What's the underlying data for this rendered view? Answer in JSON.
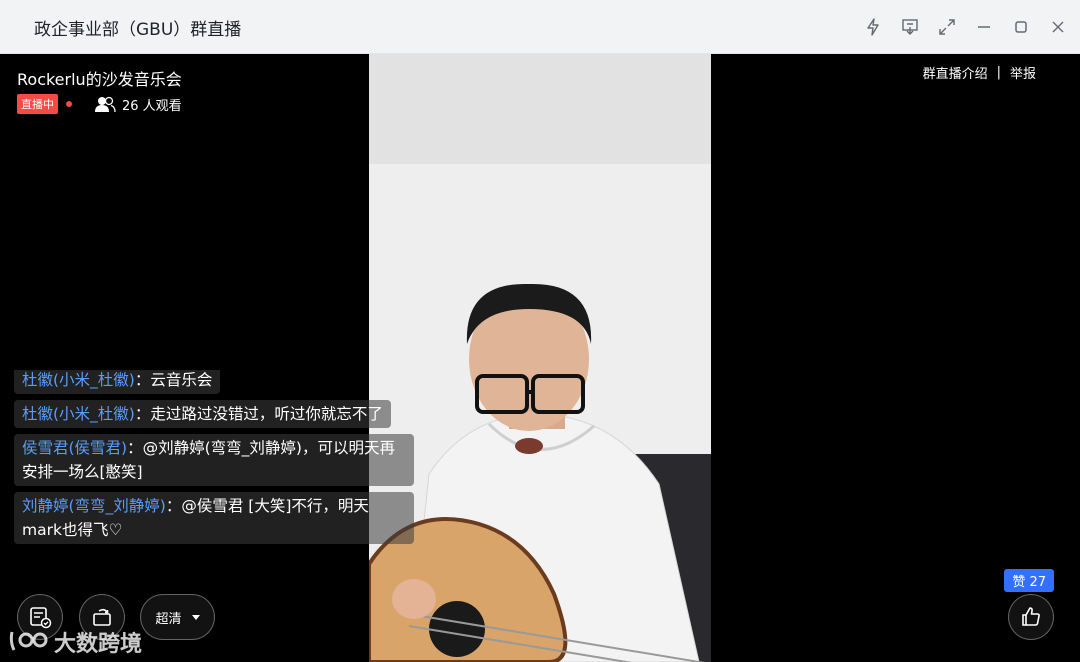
{
  "window": {
    "title": "政企事业部（GBU）群直播"
  },
  "stream": {
    "title": "Rockerlu的沙发音乐会",
    "live_badge": "直播中",
    "viewers": "26 人观看",
    "intro_link": "群直播介绍",
    "separator": "|",
    "report_link": "举报"
  },
  "chat": {
    "messages": [
      {
        "name": "杜徽(小米_杜徽)",
        "text": "：云音乐会"
      },
      {
        "name": "杜徽(小米_杜徽)",
        "text": "：走过路过没错过，听过你就忘不了"
      },
      {
        "name": "侯雪君(侯雪君)",
        "text": "：@刘静婷(弯弯_刘静婷)，可以明天再安排一场么[憨笑]"
      },
      {
        "name": "刘静婷(弯弯_刘静婷)",
        "text": "：@侯雪君 [大笑]不行，明天mark也得飞♡"
      }
    ]
  },
  "controls": {
    "quality_label": "超清",
    "likes_label": "赞 27"
  },
  "watermark": {
    "text": "大数跨境"
  },
  "colors": {
    "live": "#f54a45",
    "username": "#5a9cf8",
    "like_badge": "#3370ff"
  }
}
